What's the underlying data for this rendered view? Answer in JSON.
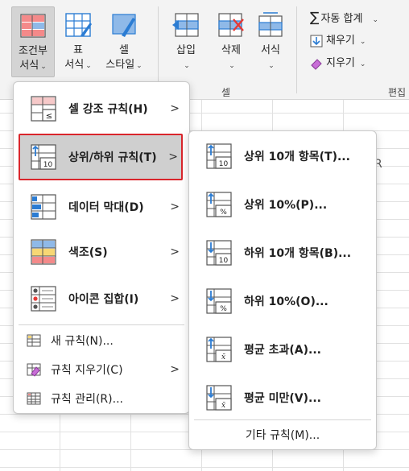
{
  "ribbon": {
    "conditional_format": {
      "line1": "조건부",
      "line2": "서식"
    },
    "table_format": {
      "line1": "표",
      "line2": "서식"
    },
    "cell_style": {
      "line1": "셀",
      "line2": "스타일"
    },
    "insert": "삽입",
    "delete": "삭제",
    "format": "서식",
    "cells_group": "셀",
    "autosum": "자동 합계",
    "fill": "채우기",
    "clear": "지우기",
    "editing_group_partial": "편집"
  },
  "sheet": {
    "partial_column": "R"
  },
  "menu_main": {
    "items": [
      {
        "label": "셀 강조 규칙(H)"
      },
      {
        "label": "상위/하위 규칙(T)"
      },
      {
        "label": "데이터 막대(D)"
      },
      {
        "label": "색조(S)"
      },
      {
        "label": "아이콘 집합(I)"
      }
    ],
    "small_items": [
      {
        "label": "새 규칙(N)..."
      },
      {
        "label": "규칙 지우기(C)"
      },
      {
        "label": "규칙 관리(R)..."
      }
    ],
    "arrow": ">"
  },
  "menu_sub": {
    "items": [
      {
        "label": "상위 10개 항목(T)..."
      },
      {
        "label": "상위 10%(P)..."
      },
      {
        "label": "하위 10개 항목(B)..."
      },
      {
        "label": "하위 10%(O)..."
      },
      {
        "label": "평균 초과(A)..."
      },
      {
        "label": "평균 미만(V)..."
      }
    ],
    "more_rules": "기타 규칙(M)...",
    "icon_text": {
      "ten": "10",
      "pct": "%",
      "xbar": "x̄"
    }
  },
  "colors": {
    "highlight_outline": "#d9262c",
    "accent_blue": "#2b7cd3",
    "accent_red": "#e53935"
  }
}
